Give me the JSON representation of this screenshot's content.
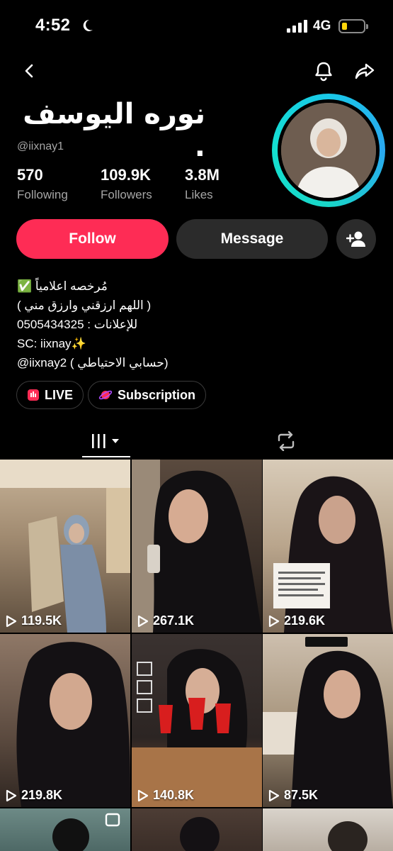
{
  "status_bar": {
    "time": "4:52",
    "network": "4G"
  },
  "profile": {
    "display_name": "نوره اليوسف .",
    "username": "@iixnay1",
    "stats": [
      {
        "value": "570",
        "label": "Following"
      },
      {
        "value": "109.9K",
        "label": "Followers"
      },
      {
        "value": "3.8M",
        "label": "Likes"
      }
    ],
    "follow_label": "Follow",
    "message_label": "Message",
    "bio_lines": [
      "مُرخصه اعلامياً ✅",
      "( اللهم ارزقني وارزق مني )",
      "للإعلانات : 0505434325",
      "SC: iixnay✨",
      "@iixnay2 ( حسابي الاحتياطي)"
    ],
    "chips": {
      "live": "LIVE",
      "subscription": "Subscription"
    }
  },
  "videos": [
    {
      "views": "119.5K"
    },
    {
      "views": "267.1K"
    },
    {
      "views": "219.6K"
    },
    {
      "views": "219.8K"
    },
    {
      "views": "140.8K"
    },
    {
      "views": "87.5K"
    }
  ],
  "colors": {
    "accent": "#fe2c55",
    "ring": "#19c8e8",
    "secondary_text": "#a6a6a6",
    "button_dark": "#2b2b2b"
  }
}
